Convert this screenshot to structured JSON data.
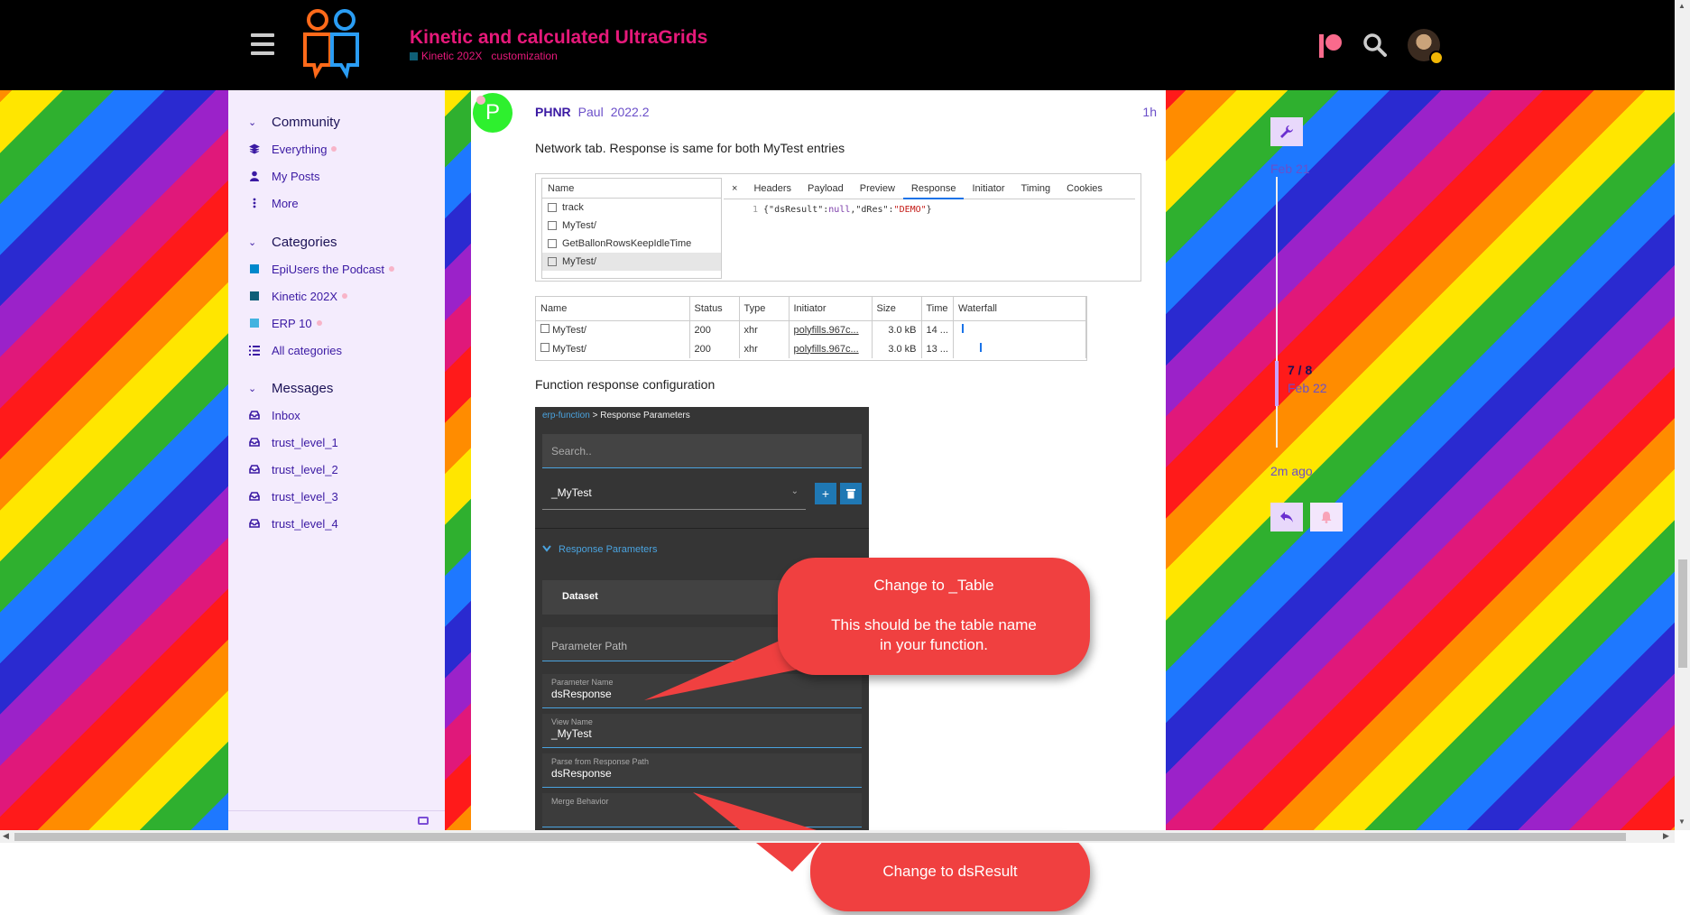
{
  "header": {
    "title": "Kinetic and calculated UltraGrids",
    "category": "Kinetic 202X",
    "tag": "customization"
  },
  "sidebar": {
    "community": {
      "title": "Community",
      "items": [
        {
          "label": "Everything"
        },
        {
          "label": "My Posts"
        },
        {
          "label": "More"
        }
      ]
    },
    "categories": {
      "title": "Categories",
      "items": [
        {
          "label": "EpiUsers the Podcast",
          "color": "#0088cc"
        },
        {
          "label": "Kinetic 202X",
          "color": "#0f5f77"
        },
        {
          "label": "ERP 10",
          "color": "#43b3e0"
        },
        {
          "label": "All categories"
        }
      ]
    },
    "messages": {
      "title": "Messages",
      "items": [
        {
          "label": "Inbox"
        },
        {
          "label": "trust_level_1"
        },
        {
          "label": "trust_level_2"
        },
        {
          "label": "trust_level_3"
        },
        {
          "label": "trust_level_4"
        }
      ]
    }
  },
  "post": {
    "avatar_letter": "P",
    "username": "PHNR",
    "name": "Paul",
    "flair": "2022.2",
    "age": "1h",
    "text1": "Network tab. Response is same for both MyTest entries",
    "text2": "Function response configuration"
  },
  "devtools1": {
    "name_header": "Name",
    "rows": [
      "track",
      "MyTest/",
      "GetBallonRowsKeepIdleTime",
      "MyTest/"
    ],
    "close": "×",
    "tabs": [
      "Headers",
      "Payload",
      "Preview",
      "Response",
      "Initiator",
      "Timing",
      "Cookies"
    ],
    "line_no": "1",
    "resp_open": "{\"dsResult\":",
    "resp_null": "null",
    "resp_mid": ",\"dRes\":",
    "resp_str": "\"DEMO\"",
    "resp_close": "}"
  },
  "devtools2": {
    "headers": [
      "Name",
      "Status",
      "Type",
      "Initiator",
      "Size",
      "Time",
      "Waterfall"
    ],
    "rows": [
      {
        "name": "MyTest/",
        "status": "200",
        "type": "xhr",
        "initiator": "polyfills.967c...",
        "size": "3.0 kB",
        "time": "14 ..."
      },
      {
        "name": "MyTest/",
        "status": "200",
        "type": "xhr",
        "initiator": "polyfills.967c...",
        "size": "3.0 kB",
        "time": "13 ..."
      }
    ]
  },
  "config": {
    "crumb_link": "erp-function",
    "crumb_sep": ">",
    "crumb_current": "Response Parameters",
    "search_placeholder": "Search..",
    "selected": "_MyTest",
    "add": "+",
    "section": "Response Parameters",
    "dataset": "Dataset",
    "param_path": "Parameter Path",
    "param_name_label": "Parameter Name",
    "param_name_value": "dsResponse",
    "view_name_label": "View Name",
    "view_name_value": "_MyTest",
    "parse_label": "Parse from Response Path",
    "parse_value": "dsResponse",
    "merge_label": "Merge Behavior"
  },
  "callouts": {
    "c1_line1": "Change to _Table",
    "c1_line2": "This should be the table name",
    "c1_line3": "in your function.",
    "c2": "Change to dsResult",
    "color": "#f04040"
  },
  "timeline": {
    "start_date": "Feb 21",
    "position": "7 / 8",
    "position_date": "Feb 22",
    "end": "2m ago"
  },
  "colors": {
    "accent": "#e6197a",
    "link": "#3b1aa3",
    "sidebar_bg": "#f4ecfd"
  }
}
